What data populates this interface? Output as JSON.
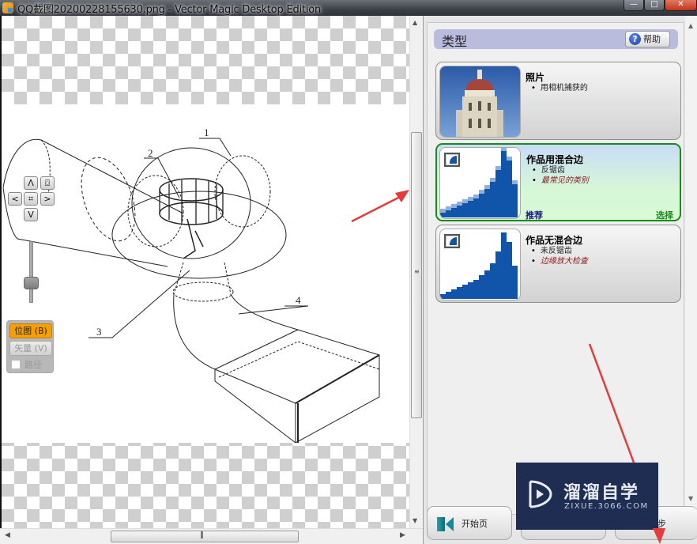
{
  "window": {
    "title": "QQ截图20200228155630.png - Vector Magic Desktop Edition",
    "controls": {
      "minimize": "—",
      "maximize": "□",
      "close": "✕"
    }
  },
  "canvas": {
    "drawing_labels": [
      "1",
      "2",
      "3",
      "4"
    ],
    "nav": {
      "up": "Λ",
      "down": "V",
      "left": "<",
      "right": ">",
      "center": "⌗",
      "fit": "⌼"
    },
    "zoom_level": 0.7,
    "mode": {
      "bitmap": "位图 (B)",
      "vector": "矢量 (V)",
      "path": "路径",
      "active": "bitmap"
    }
  },
  "scrollbars": {
    "grip": "≡",
    "hgrip": "|||",
    "up": "▲",
    "down": "▼",
    "left": "◀",
    "right": "▶"
  },
  "panel": {
    "header": "类型",
    "help_button": "帮助",
    "help_icon": "?",
    "cards": [
      {
        "title": "照片",
        "bullets": [
          {
            "text": "用相机捕获的",
            "emphasis": false
          }
        ],
        "icon": "photo-tower-thumbnail"
      },
      {
        "title": "作品用混合边",
        "bullets": [
          {
            "text": "反锯齿",
            "emphasis": false
          },
          {
            "text": "最常见的类别",
            "emphasis": true
          }
        ],
        "recommended": "推荐",
        "select": "选择",
        "selected": true,
        "icon": "antialiased-art-thumbnail"
      },
      {
        "title": "作品无混合边",
        "bullets": [
          {
            "text": "未反锯齿",
            "emphasis": false
          },
          {
            "text": "边缘放大检查",
            "emphasis": true
          }
        ],
        "icon": "aliased-art-thumbnail"
      }
    ]
  },
  "footer": {
    "start_button": "开始页",
    "back_button": "",
    "next_button": "下一步",
    "next_visible_fragment": "步"
  },
  "watermark": {
    "brand_cn": "溜溜自学",
    "brand_url": "ZIXUE.3066.COM"
  },
  "colors": {
    "accent_green": "#1a8a1a",
    "mode_active": "#f5a000",
    "header_bg": "#b9bcdc",
    "art_blue": "#1155aa",
    "annotation_red": "#e53b3b"
  }
}
